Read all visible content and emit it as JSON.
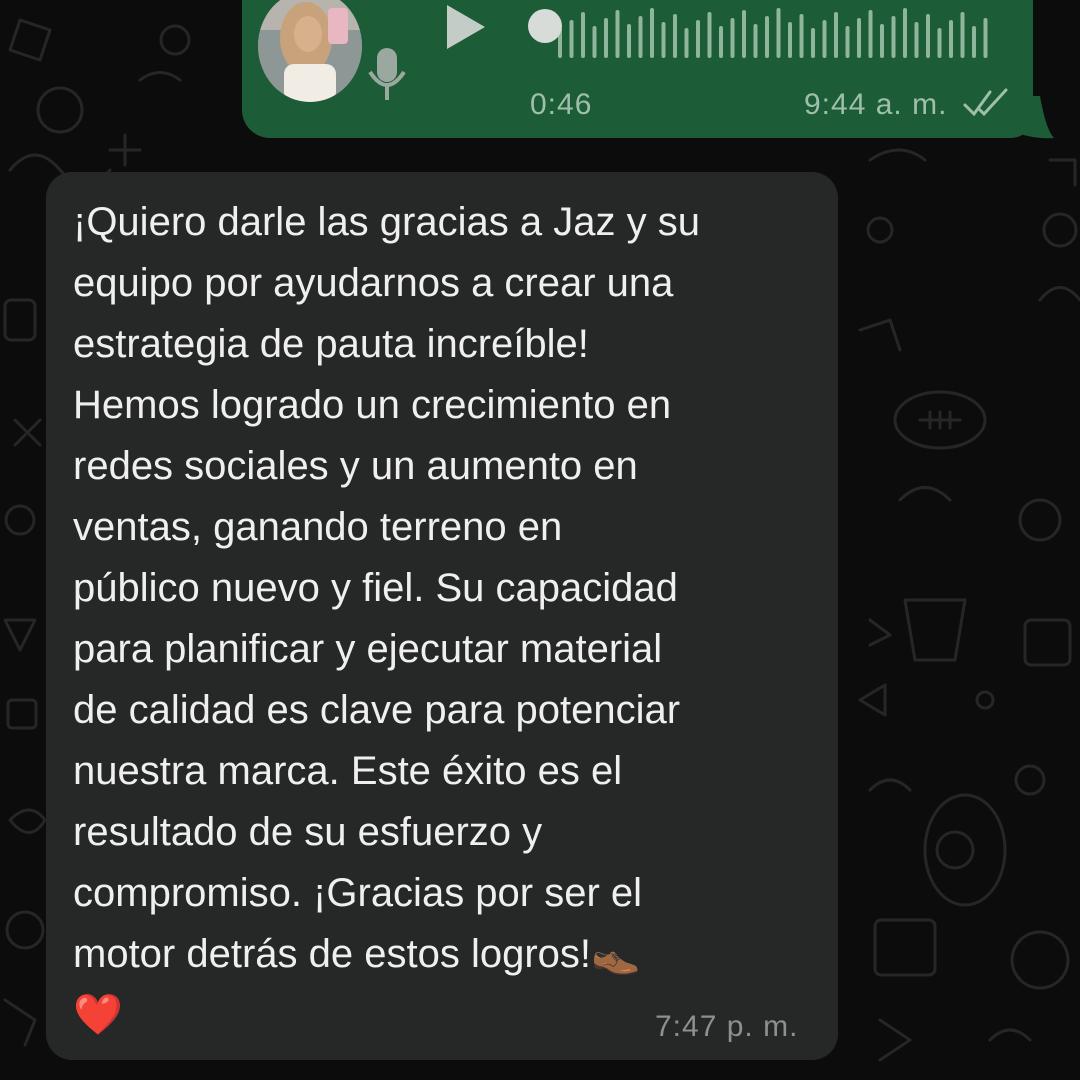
{
  "voice_message": {
    "duration": "0:46",
    "time": "9:44 a. m.",
    "status_icon": "double-check-icon",
    "play_icon": "play-icon",
    "mic_icon": "microphone-icon",
    "progress": 0,
    "bubble_color": "#1c5c36"
  },
  "text_message": {
    "text": "¡Quiero darle las gracias a Jaz y su\nequipo por ayudarnos a crear una\nestrategia de pauta increíble!\nHemos logrado un crecimiento en\nredes sociales y un aumento en\nventas, ganando terreno en\npúblico nuevo y fiel. Su capacidad\npara planificar y ejecutar material\nde calidad es clave para potenciar\nnuestra marca. Este éxito es el\nresultado de su esfuerzo y\ncompromiso. ¡Gracias por ser el\nmotor detrás de estos logros!👞\n❤️",
    "time": "7:47 p. m.",
    "bubble_color": "#262727"
  },
  "chat_background_color": "#0c0c0c"
}
